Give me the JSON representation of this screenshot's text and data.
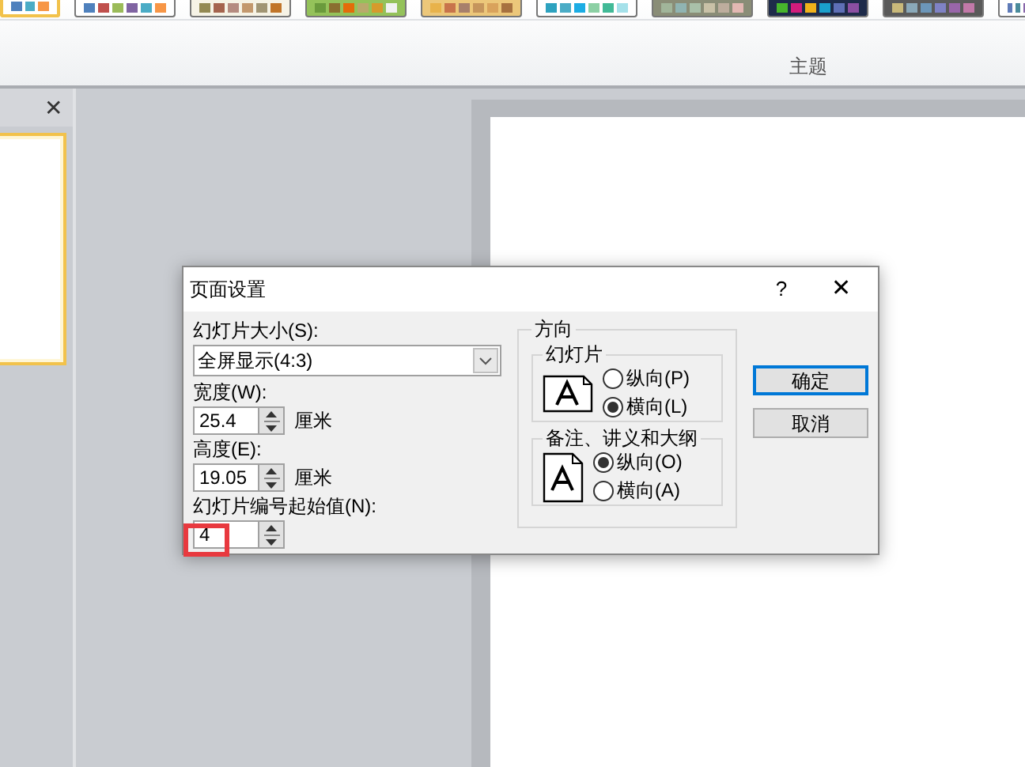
{
  "ribbon": {
    "themes": [
      {
        "selected": true
      },
      {
        "selected": false
      },
      {
        "selected": false
      },
      {
        "selected": false
      },
      {
        "selected": false
      },
      {
        "selected": false
      },
      {
        "selected": false
      },
      {
        "selected": false
      },
      {
        "selected": false
      },
      {
        "selected": false
      }
    ],
    "group_label": "主题"
  },
  "slides_pane": {
    "close": "✕"
  },
  "dialog": {
    "title": "页面设置",
    "help": "?",
    "close": "✕",
    "size_label": "幻灯片大小(S):",
    "size_value": "全屏显示(4:3)",
    "width_label": "宽度(W):",
    "width_value": "25.4",
    "width_unit": "厘米",
    "height_label": "高度(E):",
    "height_value": "19.05",
    "height_unit": "厘米",
    "number_label": "幻灯片编号起始值(N):",
    "number_value": "4",
    "orientation": {
      "title": "方向",
      "groups": [
        {
          "title": "幻灯片",
          "kind": "landscape",
          "options": [
            {
              "label": "纵向(P)",
              "selected": false
            },
            {
              "label": "横向(L)",
              "selected": true
            }
          ]
        },
        {
          "title": "备注、讲义和大纲",
          "kind": "portrait",
          "options": [
            {
              "label": "纵向(O)",
              "selected": true
            },
            {
              "label": "横向(A)",
              "selected": false
            }
          ]
        }
      ]
    },
    "buttons": [
      {
        "label": "确定",
        "default": true
      },
      {
        "label": "取消",
        "default": false
      }
    ]
  }
}
